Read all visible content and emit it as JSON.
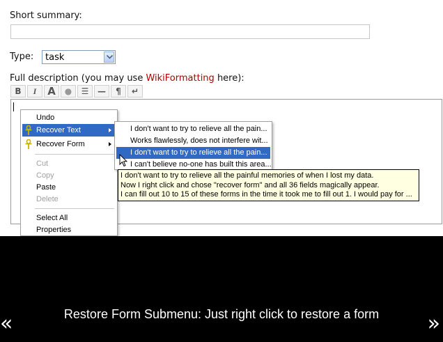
{
  "form": {
    "short_summary_label": "Short summary:",
    "short_summary_value": "",
    "type_label": "Type:",
    "type_value": "task",
    "description_label_prefix": "Full description (you may use ",
    "description_label_link": "WikiFormatting",
    "description_label_suffix": " here):"
  },
  "toolbar": {
    "buttons": [
      {
        "icon": "bold-icon",
        "glyph": "B"
      },
      {
        "icon": "italic-icon",
        "glyph": "I"
      },
      {
        "icon": "heading-icon",
        "glyph": "A"
      },
      {
        "icon": "link-icon",
        "glyph": "●"
      },
      {
        "icon": "code-icon",
        "glyph": "☰"
      },
      {
        "icon": "horizontal-rule-icon",
        "glyph": "—"
      },
      {
        "icon": "paragraph-icon",
        "glyph": "¶"
      },
      {
        "icon": "line-break-icon",
        "glyph": "↵"
      }
    ]
  },
  "context_menu": {
    "undo": "Undo",
    "recover_text": "Recover Text",
    "recover_form": "Recover Form",
    "cut": "Cut",
    "copy": "Copy",
    "paste": "Paste",
    "delete": "Delete",
    "select_all": "Select All",
    "properties": "Properties"
  },
  "submenu": {
    "items": [
      "I don't want to try to relieve all the pain...",
      "Works flawlessly, does not interfere wit...",
      "I don't want to try to relieve all the pain...",
      "I can't believe no-one has built this area..."
    ],
    "highlighted_index": 2
  },
  "tooltip": {
    "lines": [
      "I don't want to try to relieve all the painful memories of when I lost my data.",
      "Now I right click and chose \"recover form\" and all 36 fields magically appear.",
      "I can fill out 10 to 15 of these forms in the time it took me to fill out 1. I would pay for ..."
    ]
  },
  "caption": "Restore Form Submenu: Just right click to restore a form",
  "nav": {
    "prev": "«",
    "next": "»"
  },
  "colors": {
    "highlight": "#316ac5",
    "tooltip_bg": "#ffffe1",
    "link": "#b00000"
  }
}
